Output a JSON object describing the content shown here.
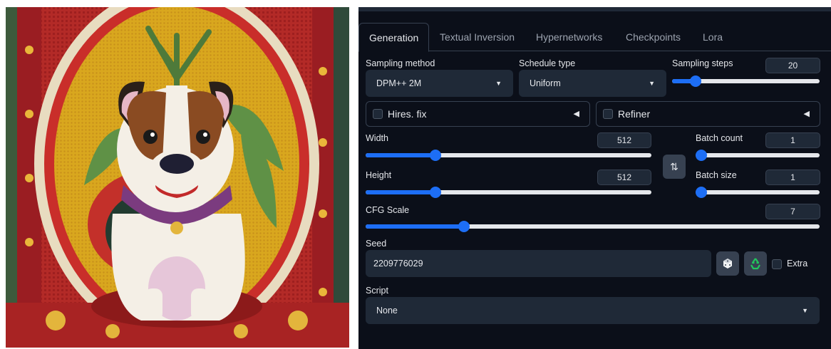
{
  "image": {
    "subject": "embroidered-bulldog-portrait"
  },
  "tabs": [
    "Generation",
    "Textual Inversion",
    "Hypernetworks",
    "Checkpoints",
    "Lora"
  ],
  "active_tab": "Generation",
  "sampling_method": {
    "label": "Sampling method",
    "value": "DPM++ 2M"
  },
  "schedule_type": {
    "label": "Schedule type",
    "value": "Uniform"
  },
  "sampling_steps": {
    "label": "Sampling steps",
    "value": "20",
    "fraction": 0.13
  },
  "hires": {
    "label": "Hires. fix"
  },
  "refiner": {
    "label": "Refiner"
  },
  "width": {
    "label": "Width",
    "value": "512",
    "fraction": 0.235
  },
  "height": {
    "label": "Height",
    "value": "512",
    "fraction": 0.235
  },
  "swap_icon": "swap-arrows-icon",
  "batch_count": {
    "label": "Batch count",
    "value": "1",
    "fraction": 0.0
  },
  "batch_size": {
    "label": "Batch size",
    "value": "1",
    "fraction": 0.0
  },
  "cfg_scale": {
    "label": "CFG Scale",
    "value": "7",
    "fraction": 0.21
  },
  "seed": {
    "label": "Seed",
    "value": "2209776029"
  },
  "dice_icon": "dice-icon",
  "recycle_icon": "recycle-icon",
  "extra": {
    "label": "Extra"
  },
  "script": {
    "label": "Script",
    "value": "None"
  },
  "colors": {
    "panel": "#0b0f19",
    "field": "#1f2937",
    "accent": "#1d6ef5",
    "recycle": "#22c55e"
  }
}
